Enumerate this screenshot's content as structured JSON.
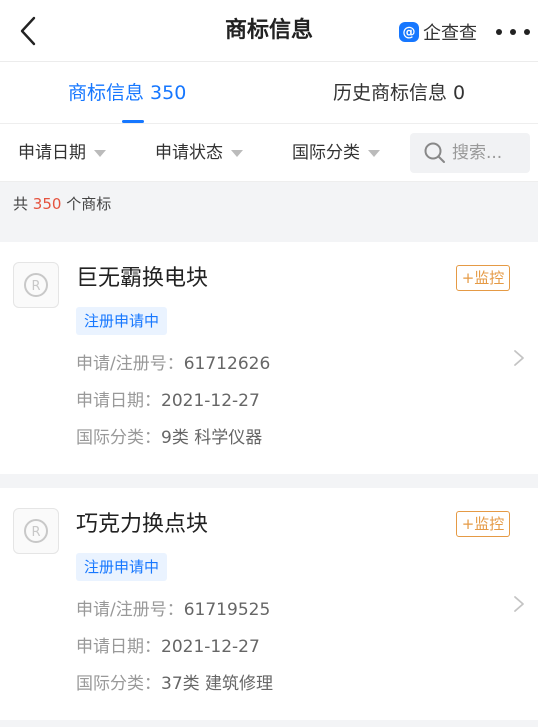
{
  "header": {
    "title": "商标信息",
    "brand_icon_letter": "@",
    "brand_name": "企查查",
    "icons": {
      "back": "chevron-left-icon",
      "more": "more-dots-icon",
      "brand": "qichacha-logo-icon"
    },
    "brand_color": "#1677ff"
  },
  "tabs": [
    {
      "label": "商标信息 350",
      "active": true
    },
    {
      "label": "历史商标信息 0",
      "active": false
    }
  ],
  "filters": {
    "items": [
      {
        "label": "申请日期"
      },
      {
        "label": "申请状态"
      },
      {
        "label": "国际分类"
      }
    ],
    "search_placeholder": "搜索..."
  },
  "summary": {
    "prefix": "共 ",
    "count": "350",
    "suffix": " 个商标"
  },
  "colors": {
    "accent": "#1677ff",
    "count_highlight": "#e5533f",
    "monitor": "#e59a45",
    "status_bg": "#eaf3ff"
  },
  "trademarks": [
    {
      "name": "巨无霸换电块",
      "status": "注册申请中",
      "monitor_label": "+监控",
      "reg_label": "申请/注册号：",
      "reg_value": "61712626",
      "date_label": "申请日期：",
      "date_value": "2021-12-27",
      "class_label": "国际分类：",
      "class_value": "9类 科学仪器"
    },
    {
      "name": "巧克力换点块",
      "status": "注册申请中",
      "monitor_label": "+监控",
      "reg_label": "申请/注册号：",
      "reg_value": "61719525",
      "date_label": "申请日期：",
      "date_value": "2021-12-27",
      "class_label": "国际分类：",
      "class_value": "37类 建筑修理"
    }
  ]
}
